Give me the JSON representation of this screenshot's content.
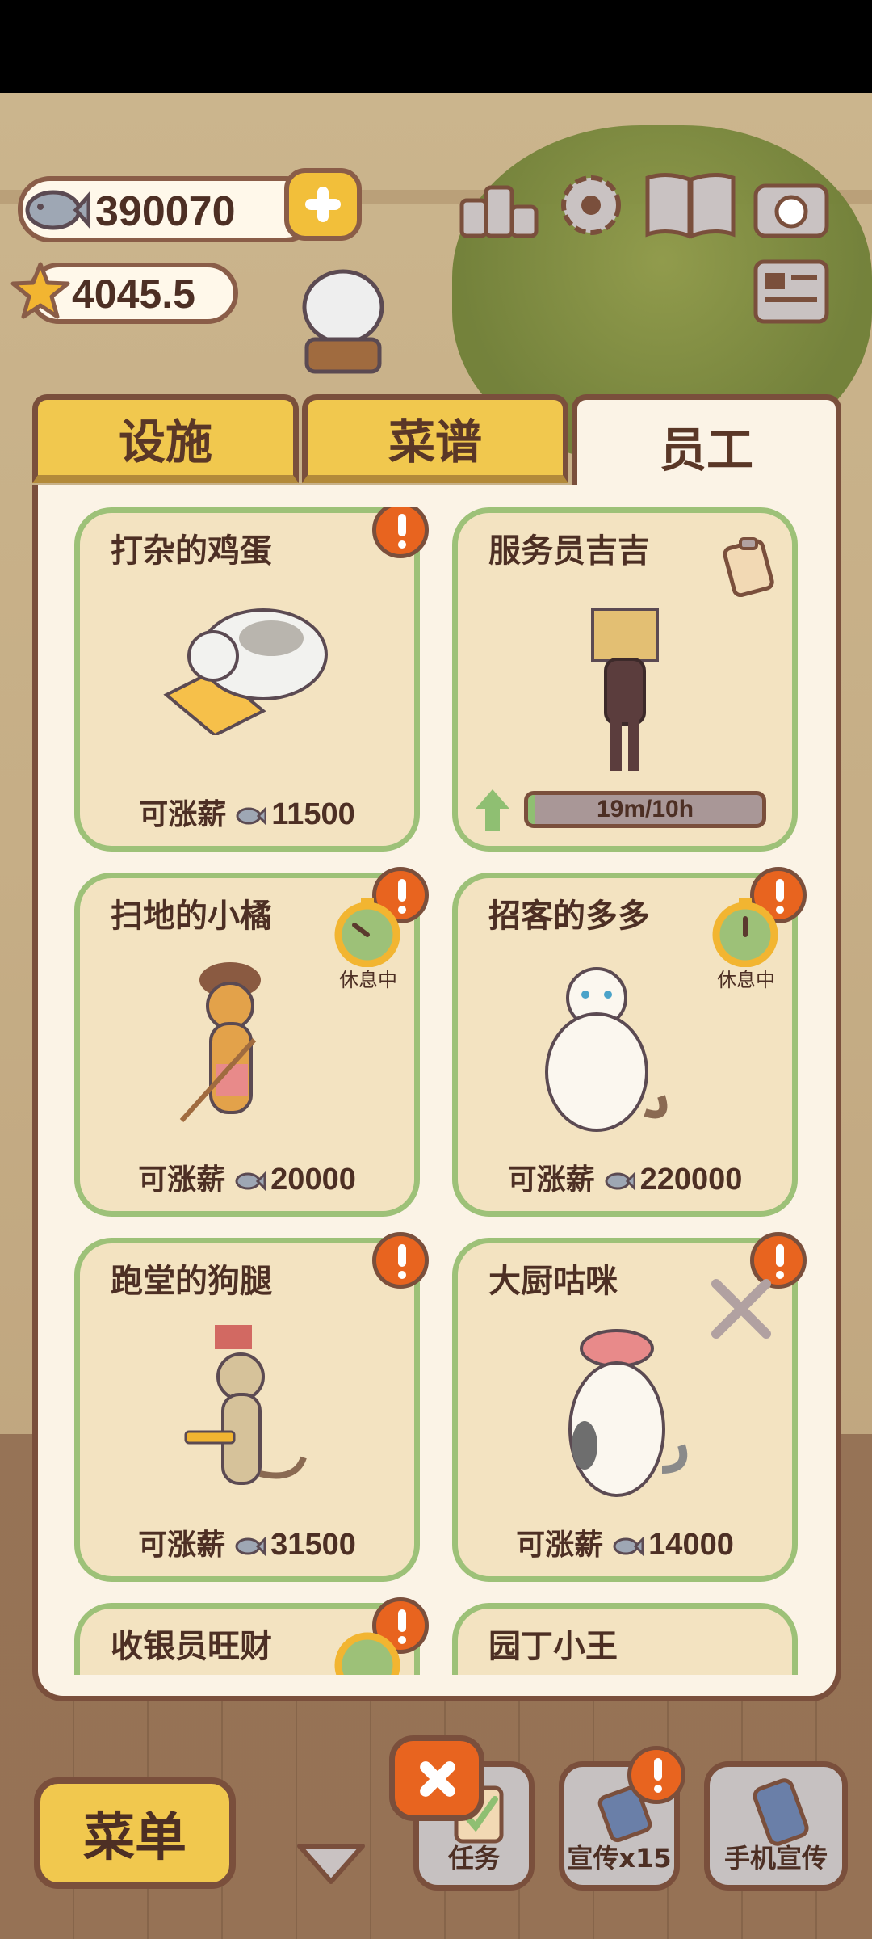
{
  "currency": {
    "fish": "390070",
    "stars": "4045.5"
  },
  "tabs": [
    {
      "label": "设施",
      "active": false
    },
    {
      "label": "菜谱",
      "active": false
    },
    {
      "label": "员工",
      "active": true
    }
  ],
  "staff": [
    {
      "name": "打杂的鸡蛋",
      "salary_label": "可涨薪",
      "salary": "11500",
      "alert": true
    },
    {
      "name": "服务员吉吉",
      "progress_text": "19m/10h",
      "progress_fraction": 0.03
    },
    {
      "name": "扫地的小橘",
      "salary_label": "可涨薪",
      "salary": "20000",
      "alert": true,
      "status": "休息中"
    },
    {
      "name": "招客的多多",
      "salary_label": "可涨薪",
      "salary": "220000",
      "alert": true,
      "status": "休息中"
    },
    {
      "name": "跑堂的狗腿",
      "salary_label": "可涨薪",
      "salary": "31500",
      "alert": true
    },
    {
      "name": "大厨咕咪",
      "salary_label": "可涨薪",
      "salary": "14000",
      "alert": true
    },
    {
      "name": "收银员旺财",
      "alert": true
    },
    {
      "name": "园丁小王"
    }
  ],
  "bottom": {
    "menu_label": "菜单",
    "task_label": "任务",
    "promo_label": "宣传x15",
    "phone_label": "手机宣传"
  },
  "colors": {
    "accent_yellow": "#f1c84e",
    "alert_orange": "#e8641f",
    "card_border": "#9dc178",
    "outline": "#7a4f3c"
  }
}
